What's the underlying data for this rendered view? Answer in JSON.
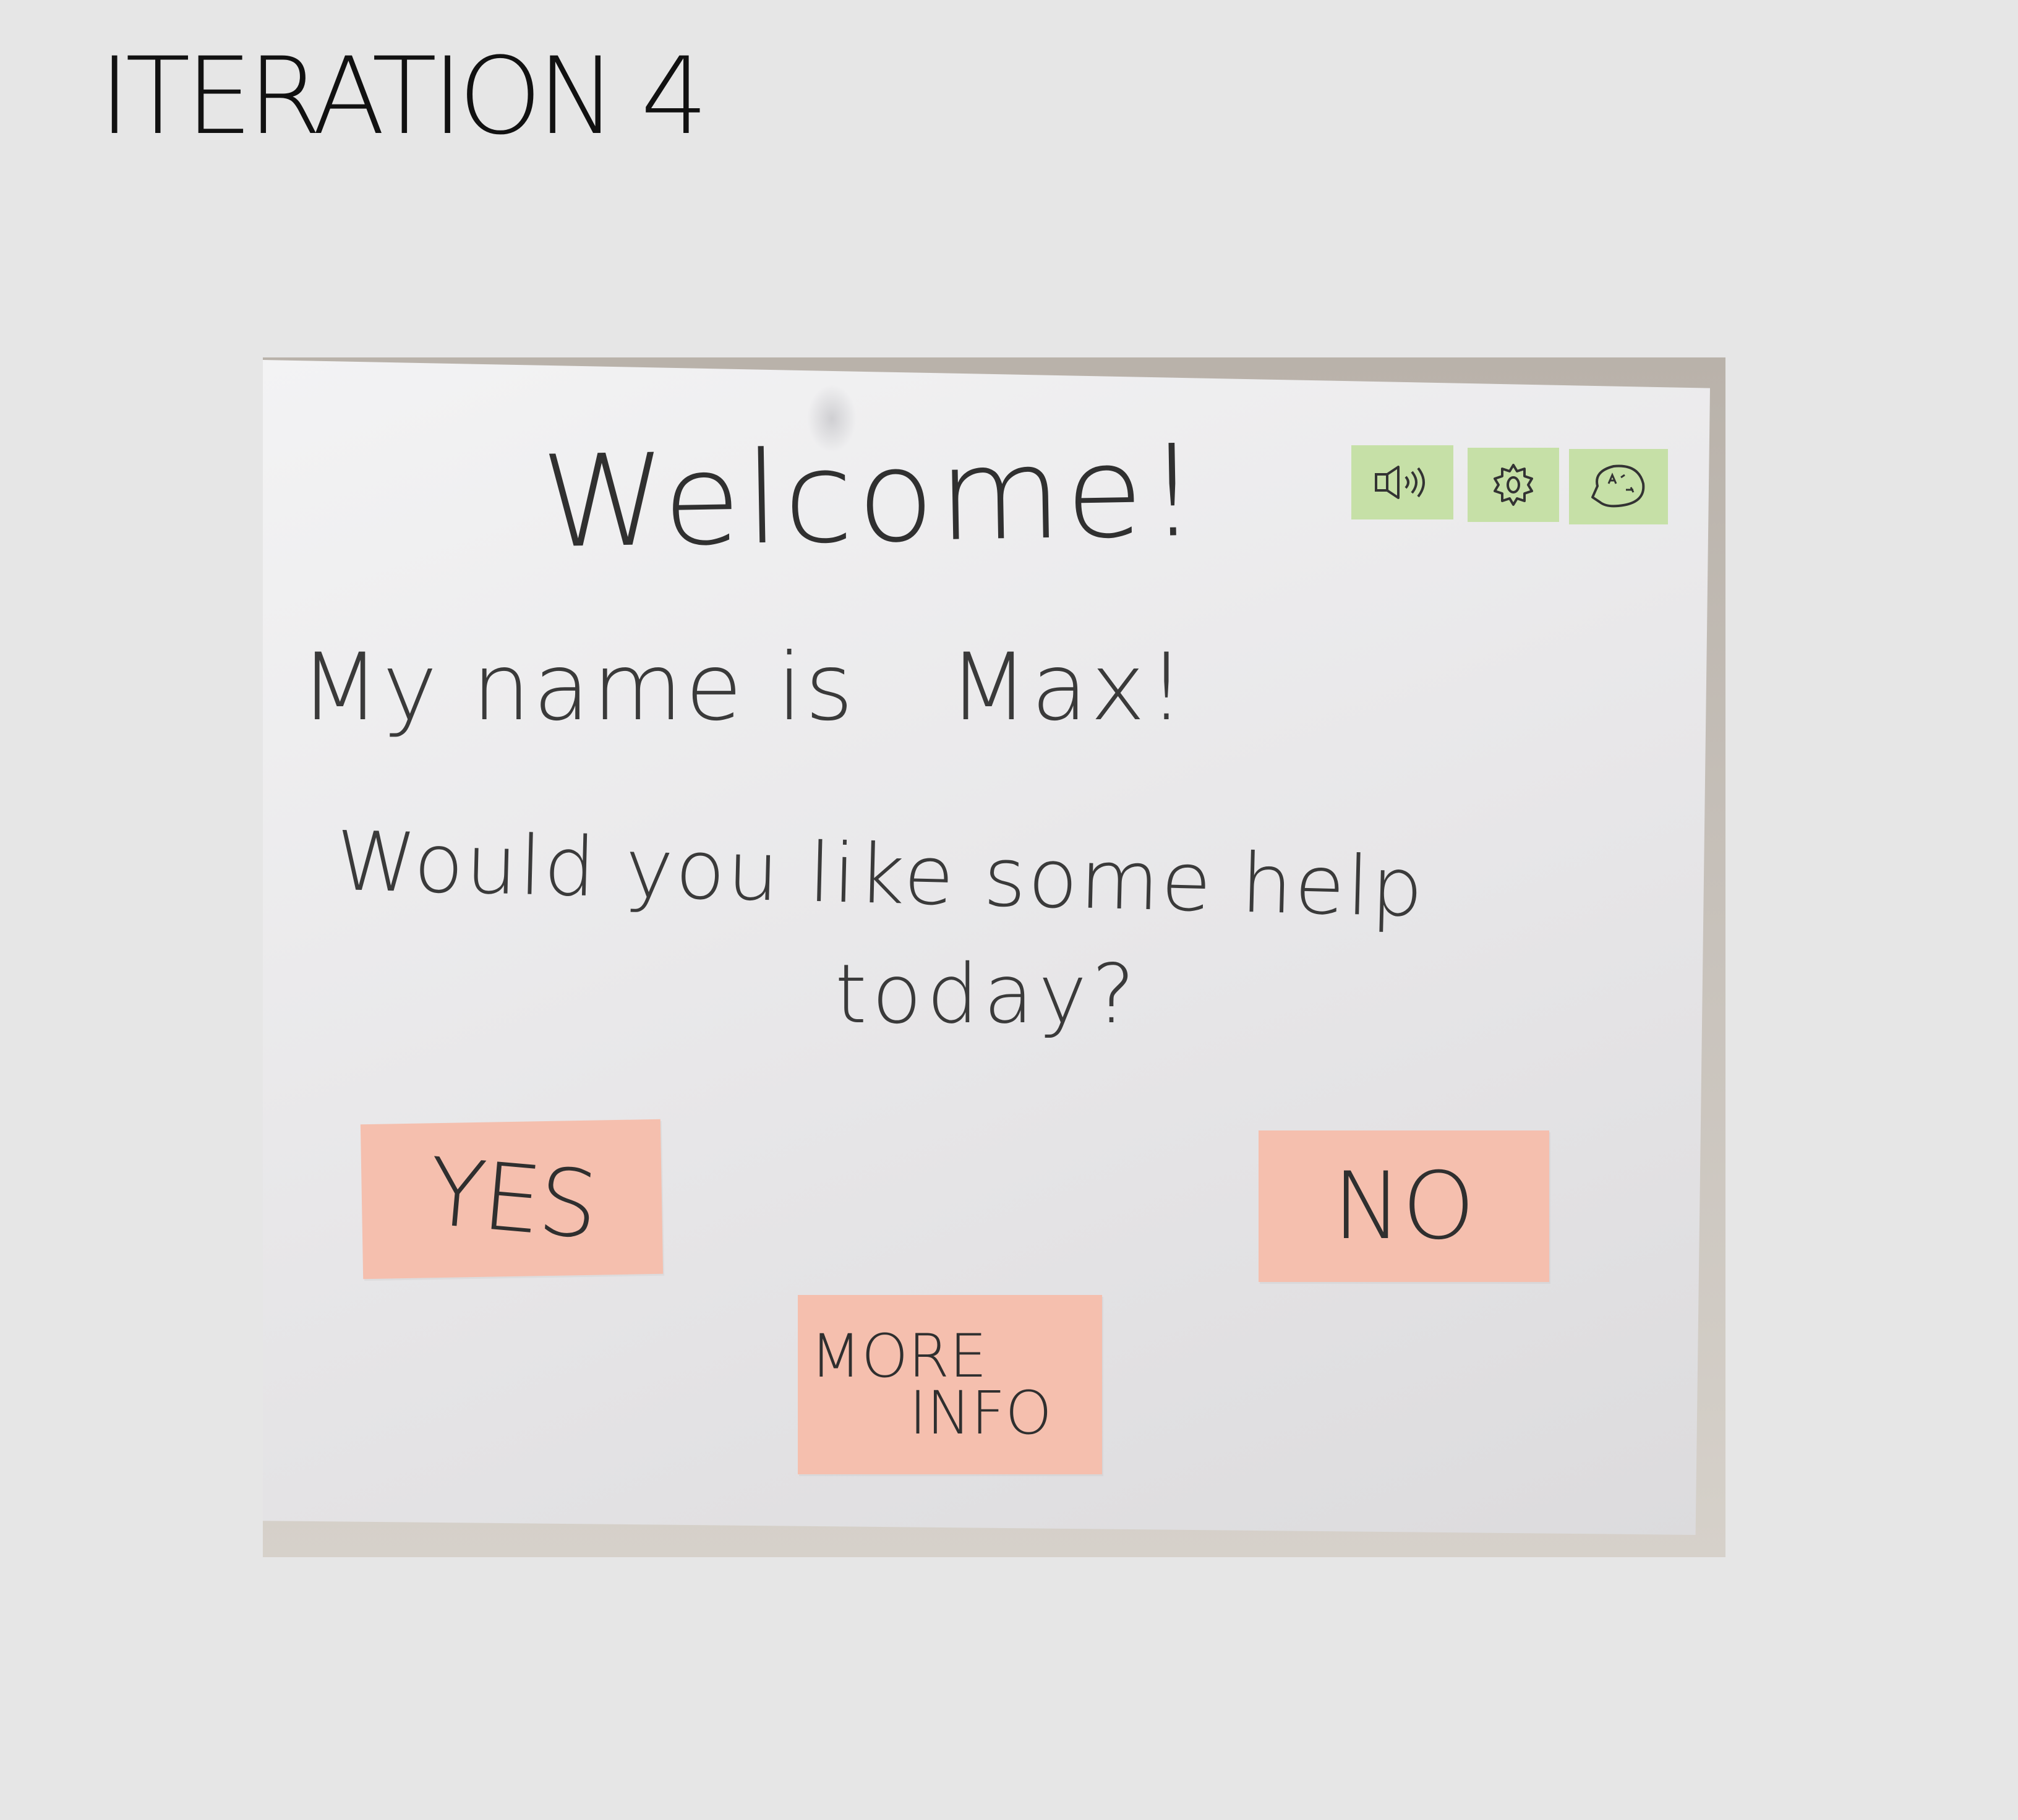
{
  "page": {
    "title": "ITERATION 4"
  },
  "prototype": {
    "greeting": "Welcome!",
    "intro_part1": "My name is",
    "intro_part2": "Max!",
    "question_line1": "Would you like some help",
    "question_line2": "today?",
    "buttons": {
      "yes": "YES",
      "no": "NO",
      "more_line1": "MORE",
      "more_line2": "INFO"
    },
    "icons": [
      "speaker-icon",
      "gear-icon",
      "chat-icon"
    ]
  },
  "colors": {
    "background": "#e6e6e6",
    "paper": "#ececed",
    "button_note": "#f5bfae",
    "icon_note": "#c6e0a7",
    "ink": "#3a3a3a"
  }
}
